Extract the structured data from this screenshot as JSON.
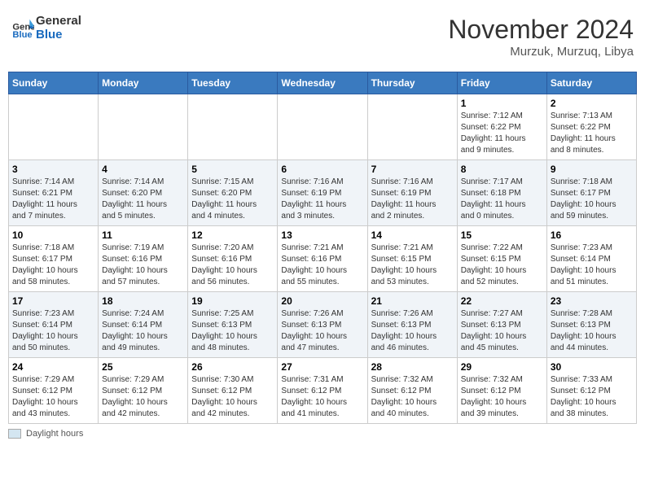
{
  "header": {
    "logo_general": "General",
    "logo_blue": "Blue",
    "month_year": "November 2024",
    "location": "Murzuk, Murzuq, Libya"
  },
  "days_of_week": [
    "Sunday",
    "Monday",
    "Tuesday",
    "Wednesday",
    "Thursday",
    "Friday",
    "Saturday"
  ],
  "legend": {
    "label": "Daylight hours"
  },
  "weeks": [
    {
      "days": [
        {
          "number": "",
          "info": ""
        },
        {
          "number": "",
          "info": ""
        },
        {
          "number": "",
          "info": ""
        },
        {
          "number": "",
          "info": ""
        },
        {
          "number": "",
          "info": ""
        },
        {
          "number": "1",
          "info": "Sunrise: 7:12 AM\nSunset: 6:22 PM\nDaylight: 11 hours\nand 9 minutes."
        },
        {
          "number": "2",
          "info": "Sunrise: 7:13 AM\nSunset: 6:22 PM\nDaylight: 11 hours\nand 8 minutes."
        }
      ]
    },
    {
      "days": [
        {
          "number": "3",
          "info": "Sunrise: 7:14 AM\nSunset: 6:21 PM\nDaylight: 11 hours\nand 7 minutes."
        },
        {
          "number": "4",
          "info": "Sunrise: 7:14 AM\nSunset: 6:20 PM\nDaylight: 11 hours\nand 5 minutes."
        },
        {
          "number": "5",
          "info": "Sunrise: 7:15 AM\nSunset: 6:20 PM\nDaylight: 11 hours\nand 4 minutes."
        },
        {
          "number": "6",
          "info": "Sunrise: 7:16 AM\nSunset: 6:19 PM\nDaylight: 11 hours\nand 3 minutes."
        },
        {
          "number": "7",
          "info": "Sunrise: 7:16 AM\nSunset: 6:19 PM\nDaylight: 11 hours\nand 2 minutes."
        },
        {
          "number": "8",
          "info": "Sunrise: 7:17 AM\nSunset: 6:18 PM\nDaylight: 11 hours\nand 0 minutes."
        },
        {
          "number": "9",
          "info": "Sunrise: 7:18 AM\nSunset: 6:17 PM\nDaylight: 10 hours\nand 59 minutes."
        }
      ]
    },
    {
      "days": [
        {
          "number": "10",
          "info": "Sunrise: 7:18 AM\nSunset: 6:17 PM\nDaylight: 10 hours\nand 58 minutes."
        },
        {
          "number": "11",
          "info": "Sunrise: 7:19 AM\nSunset: 6:16 PM\nDaylight: 10 hours\nand 57 minutes."
        },
        {
          "number": "12",
          "info": "Sunrise: 7:20 AM\nSunset: 6:16 PM\nDaylight: 10 hours\nand 56 minutes."
        },
        {
          "number": "13",
          "info": "Sunrise: 7:21 AM\nSunset: 6:16 PM\nDaylight: 10 hours\nand 55 minutes."
        },
        {
          "number": "14",
          "info": "Sunrise: 7:21 AM\nSunset: 6:15 PM\nDaylight: 10 hours\nand 53 minutes."
        },
        {
          "number": "15",
          "info": "Sunrise: 7:22 AM\nSunset: 6:15 PM\nDaylight: 10 hours\nand 52 minutes."
        },
        {
          "number": "16",
          "info": "Sunrise: 7:23 AM\nSunset: 6:14 PM\nDaylight: 10 hours\nand 51 minutes."
        }
      ]
    },
    {
      "days": [
        {
          "number": "17",
          "info": "Sunrise: 7:23 AM\nSunset: 6:14 PM\nDaylight: 10 hours\nand 50 minutes."
        },
        {
          "number": "18",
          "info": "Sunrise: 7:24 AM\nSunset: 6:14 PM\nDaylight: 10 hours\nand 49 minutes."
        },
        {
          "number": "19",
          "info": "Sunrise: 7:25 AM\nSunset: 6:13 PM\nDaylight: 10 hours\nand 48 minutes."
        },
        {
          "number": "20",
          "info": "Sunrise: 7:26 AM\nSunset: 6:13 PM\nDaylight: 10 hours\nand 47 minutes."
        },
        {
          "number": "21",
          "info": "Sunrise: 7:26 AM\nSunset: 6:13 PM\nDaylight: 10 hours\nand 46 minutes."
        },
        {
          "number": "22",
          "info": "Sunrise: 7:27 AM\nSunset: 6:13 PM\nDaylight: 10 hours\nand 45 minutes."
        },
        {
          "number": "23",
          "info": "Sunrise: 7:28 AM\nSunset: 6:13 PM\nDaylight: 10 hours\nand 44 minutes."
        }
      ]
    },
    {
      "days": [
        {
          "number": "24",
          "info": "Sunrise: 7:29 AM\nSunset: 6:12 PM\nDaylight: 10 hours\nand 43 minutes."
        },
        {
          "number": "25",
          "info": "Sunrise: 7:29 AM\nSunset: 6:12 PM\nDaylight: 10 hours\nand 42 minutes."
        },
        {
          "number": "26",
          "info": "Sunrise: 7:30 AM\nSunset: 6:12 PM\nDaylight: 10 hours\nand 42 minutes."
        },
        {
          "number": "27",
          "info": "Sunrise: 7:31 AM\nSunset: 6:12 PM\nDaylight: 10 hours\nand 41 minutes."
        },
        {
          "number": "28",
          "info": "Sunrise: 7:32 AM\nSunset: 6:12 PM\nDaylight: 10 hours\nand 40 minutes."
        },
        {
          "number": "29",
          "info": "Sunrise: 7:32 AM\nSunset: 6:12 PM\nDaylight: 10 hours\nand 39 minutes."
        },
        {
          "number": "30",
          "info": "Sunrise: 7:33 AM\nSunset: 6:12 PM\nDaylight: 10 hours\nand 38 minutes."
        }
      ]
    }
  ]
}
